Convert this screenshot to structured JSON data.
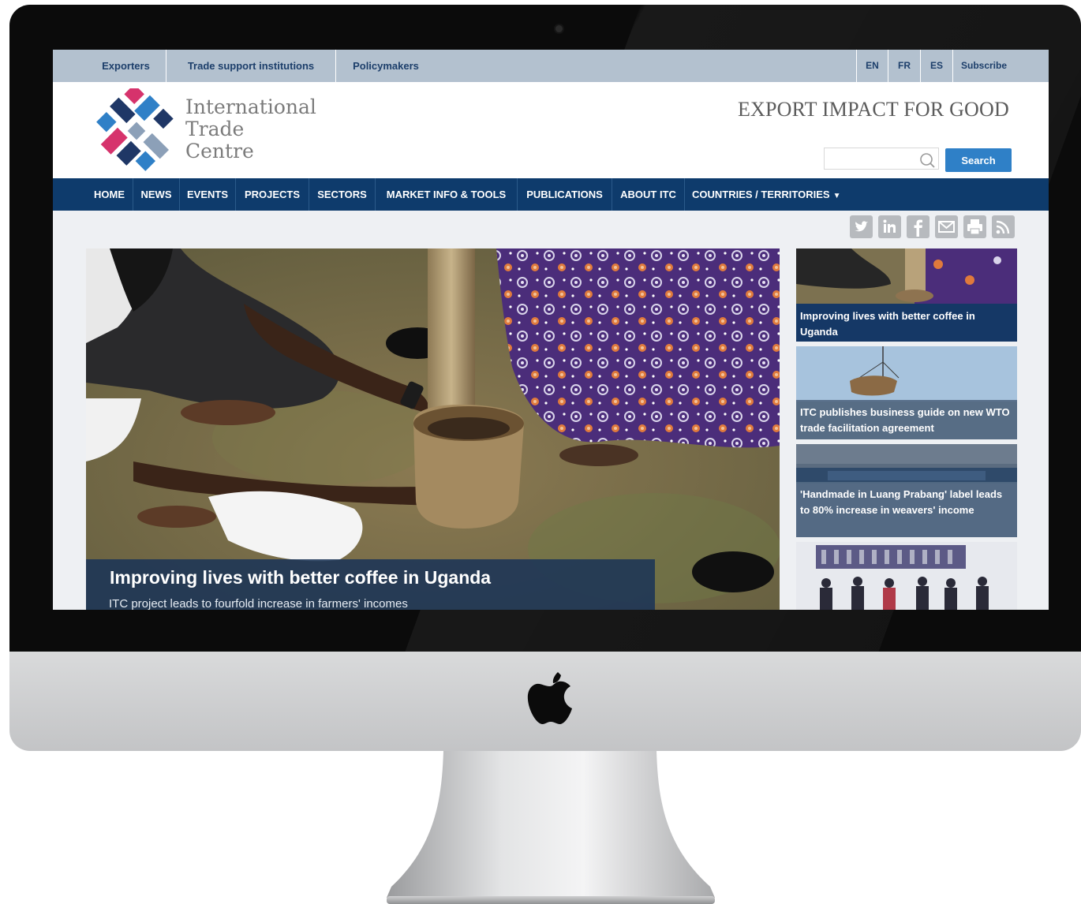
{
  "utility_nav": {
    "items": [
      "Exporters",
      "Trade support institutions",
      "Policymakers"
    ],
    "languages": [
      "EN",
      "FR",
      "ES"
    ],
    "subscribe": "Subscribe"
  },
  "header": {
    "logo_lines": [
      "International",
      "Trade",
      "Centre"
    ],
    "tagline": "EXPORT IMPACT FOR GOOD",
    "search_placeholder": "",
    "search_button": "Search"
  },
  "main_nav": {
    "items": [
      "HOME",
      "NEWS",
      "EVENTS",
      "PROJECTS",
      "SECTORS",
      "MARKET INFO & TOOLS",
      "PUBLICATIONS",
      "ABOUT ITC",
      "COUNTRIES / TERRITORIES"
    ]
  },
  "share_icons": [
    "twitter-icon",
    "linkedin-icon",
    "facebook-icon",
    "email-icon",
    "print-icon",
    "rss-icon"
  ],
  "hero": {
    "title": "Improving lives with better coffee in Uganda",
    "subtitle": "ITC project leads to fourfold increase in farmers' incomes"
  },
  "side_stories": [
    {
      "title": "Improving lives with better coffee in Uganda"
    },
    {
      "title": "ITC publishes business guide on new WTO trade facilitation agreement"
    },
    {
      "title": "'Handmade in Luang Prabang' label leads to 80% increase in weavers' income"
    }
  ],
  "colors": {
    "nav_bg": "#0e3b6c",
    "utility_bg": "#b3c1cf",
    "accent_blue": "#2f80c7",
    "logo_pink": "#d6336c",
    "logo_navy": "#1f3766"
  }
}
